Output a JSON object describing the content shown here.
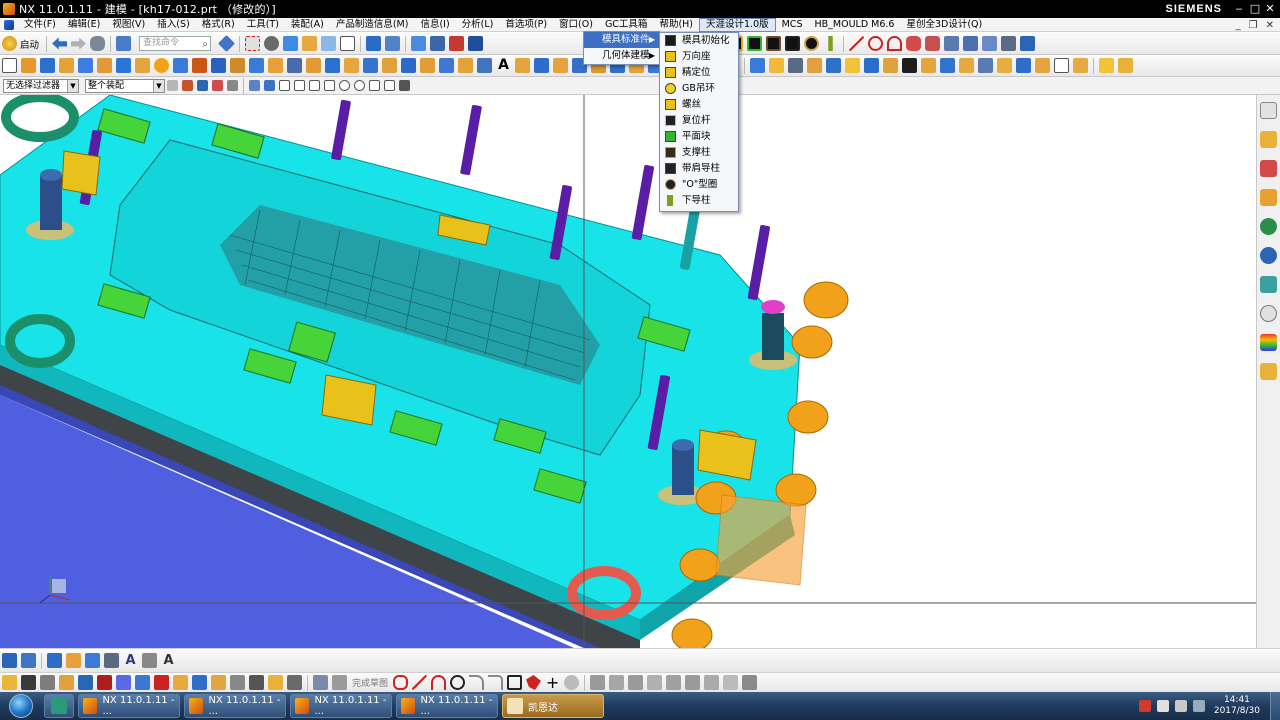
{
  "window": {
    "title": "NX 11.0.1.11 - 建模 - [kh17-012.prt （修改的）]",
    "brand": "SIEMENS"
  },
  "menubar": {
    "items": [
      "文件(F)",
      "编辑(E)",
      "视图(V)",
      "插入(S)",
      "格式(R)",
      "工具(T)",
      "装配(A)",
      "产品制造信息(M)",
      "信息(I)",
      "分析(L)",
      "首选项(P)",
      "窗口(O)",
      "GC工具箱",
      "帮助(H)",
      "天涯设计1.0版",
      "MCS",
      "HB_MOULD M6.6",
      "星创全3D设计(Q)"
    ],
    "active_index": 14
  },
  "toolbar": {
    "start_label": "启动",
    "search_placeholder": "查找命令"
  },
  "selection_bar": {
    "filter_value": "无选择过滤器",
    "scope_value": "整个装配"
  },
  "menus": {
    "level1": [
      {
        "label": "模具标准件",
        "has_submenu": true,
        "selected": true
      },
      {
        "label": "几何体建模",
        "has_submenu": true,
        "selected": false
      }
    ],
    "level2": [
      {
        "label": "模具初始化",
        "icon": "mold-init-icon",
        "color": "#1a1a1a"
      },
      {
        "label": "万向座",
        "icon": "universal-seat-icon",
        "color": "#e8c21a"
      },
      {
        "label": "精定位",
        "icon": "fine-locator-icon",
        "color": "#e8c21a"
      },
      {
        "label": "GB吊环",
        "icon": "lifting-ring-icon",
        "color": "#f2d21c"
      },
      {
        "label": "螺丝",
        "icon": "screw-icon",
        "color": "#e8c21a"
      },
      {
        "label": "复位杆",
        "icon": "return-pin-icon",
        "color": "#222222"
      },
      {
        "label": "平面块",
        "icon": "flat-block-icon",
        "color": "#2fb52f"
      },
      {
        "label": "支撑柱",
        "icon": "support-pillar-icon",
        "color": "#3a2a18"
      },
      {
        "label": "带肩导柱",
        "icon": "shoulder-guide-pillar-icon",
        "color": "#222222"
      },
      {
        "label": "\"O\"型圈",
        "icon": "o-ring-icon",
        "color": "#222222"
      },
      {
        "label": "下导柱",
        "icon": "lower-guide-pillar-icon",
        "color": "#7aa020"
      }
    ]
  },
  "bottom_toolbar": {
    "sketch_label": "完成草图"
  },
  "taskbar": {
    "apps": [
      {
        "label": "NX 11.0.1.11 - ...",
        "active": false
      },
      {
        "label": "NX 11.0.1.11 - ...",
        "active": false
      },
      {
        "label": "NX 11.0.1.11 - ...",
        "active": false
      },
      {
        "label": "NX 11.0.1.11 - ...",
        "active": false
      },
      {
        "label": "凯恩达",
        "active": true
      }
    ],
    "time": "14:41",
    "date": "2017/8/30"
  },
  "colors": {
    "mold_plate": "#17e3e8",
    "screw": "#5a1ea6",
    "cylinder": "#f2a21a",
    "base_plate": "#5a6ae6",
    "menu_highlight": "#3d6fc4"
  }
}
